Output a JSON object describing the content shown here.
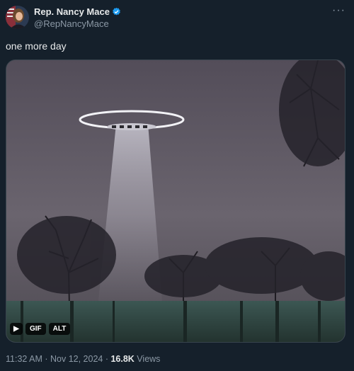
{
  "author": {
    "name": "Rep. Nancy Mace",
    "handle": "@RepNancyMace",
    "verified_icon": "verified-badge-icon",
    "avatar_icon": "profile-avatar",
    "more_label": "···"
  },
  "tweet": {
    "text": "one more day"
  },
  "media": {
    "type": "gif",
    "description_icon": "ufo-gif",
    "play_label": "▶",
    "gif_label": "GIF",
    "alt_label": "ALT"
  },
  "meta": {
    "time": "11:32 AM",
    "sep1": " · ",
    "date": "Nov 12, 2024",
    "sep2": " · ",
    "views_count": "16.8K",
    "views_label": " Views"
  },
  "colors": {
    "background": "#15202b",
    "primary_text": "#e7e9ea",
    "secondary_text": "#8b98a5",
    "verified": "#1d9bf0"
  }
}
